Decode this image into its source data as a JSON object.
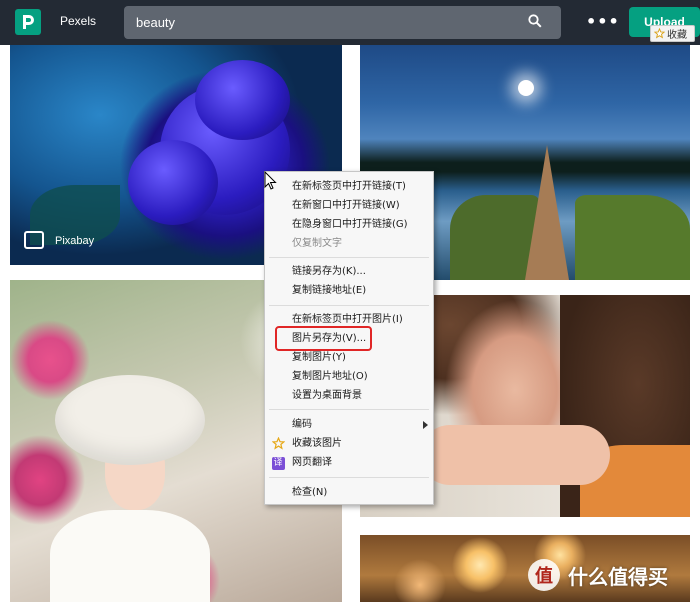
{
  "header": {
    "brand": "Pexels",
    "search_value": "beauty",
    "more_label": "•••",
    "upload_label": "Upload",
    "collect_label": "收藏"
  },
  "photos": {
    "rose_credit": "Pixabay"
  },
  "context_menu": {
    "items": [
      "在新标签页中打开链接(T)",
      "在新窗口中打开链接(W)",
      "在隐身窗口中打开链接(G)",
      "仅复制文字",
      "链接另存为(K)...",
      "复制链接地址(E)",
      "在新标签页中打开图片(I)",
      "图片另存为(V)...",
      "复制图片(Y)",
      "复制图片地址(O)",
      "设置为桌面背景",
      "编码",
      "收藏该图片",
      "网页翻译",
      "检查(N)"
    ],
    "translate_badge": "译",
    "highlighted_item": "图片另存为(V)..."
  },
  "watermark": {
    "glyph": "值",
    "text": "什么值得买"
  },
  "colors": {
    "topbar": "#232a34",
    "brand_green": "#05a081",
    "highlight_red": "#e02626"
  }
}
